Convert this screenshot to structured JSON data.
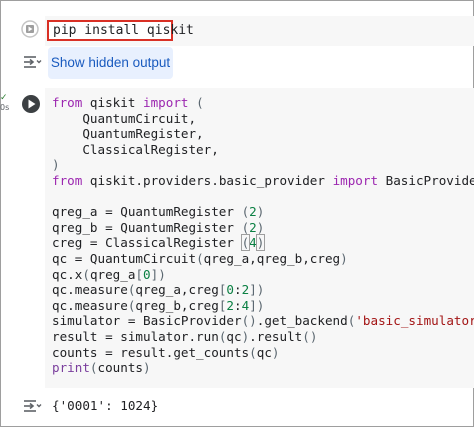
{
  "cell1": {
    "code": "pip install qiskit",
    "show_hidden_label": "Show hidden output"
  },
  "cell2": {
    "exec_status": "✓",
    "exec_time": "0s",
    "lines": [
      [
        [
          "kw",
          "from"
        ],
        [
          "t",
          " qiskit "
        ],
        [
          "kw",
          "import"
        ],
        [
          "t",
          " "
        ],
        [
          "p",
          "("
        ]
      ],
      [
        [
          "t",
          "    QuantumCircuit,"
        ]
      ],
      [
        [
          "t",
          "    QuantumRegister,"
        ]
      ],
      [
        [
          "t",
          "    ClassicalRegister,"
        ]
      ],
      [
        [
          "p",
          ")"
        ]
      ],
      [
        [
          "kw",
          "from"
        ],
        [
          "t",
          " qiskit.providers.basic_provider "
        ],
        [
          "kw",
          "import"
        ],
        [
          "t",
          " BasicProvider"
        ]
      ],
      [
        [
          "t",
          ""
        ]
      ],
      [
        [
          "t",
          "qreg_a = QuantumRegister "
        ],
        [
          "p",
          "("
        ],
        [
          "n",
          "2"
        ],
        [
          "p",
          ")"
        ]
      ],
      [
        [
          "t",
          "qreg_b = QuantumRegister "
        ],
        [
          "p",
          "("
        ],
        [
          "n",
          "2"
        ],
        [
          "p",
          ")"
        ]
      ],
      [
        [
          "t",
          "creg = ClassicalRegister "
        ],
        [
          "h",
          "("
        ],
        [
          "n",
          "4"
        ],
        [
          "h",
          ")"
        ],
        [
          "c",
          ""
        ]
      ],
      [
        [
          "t",
          "qc = QuantumCircuit"
        ],
        [
          "p",
          "("
        ],
        [
          "t",
          "qreg_a,qreg_b,creg"
        ],
        [
          "p",
          ")"
        ]
      ],
      [
        [
          "t",
          "qc.x"
        ],
        [
          "p",
          "("
        ],
        [
          "t",
          "qreg_a"
        ],
        [
          "p",
          "["
        ],
        [
          "n",
          "0"
        ],
        [
          "p",
          "])"
        ]
      ],
      [
        [
          "t",
          "qc.measure"
        ],
        [
          "p",
          "("
        ],
        [
          "t",
          "qreg_a,creg"
        ],
        [
          "p",
          "["
        ],
        [
          "n",
          "0"
        ],
        [
          "t",
          ":"
        ],
        [
          "n",
          "2"
        ],
        [
          "p",
          "])"
        ]
      ],
      [
        [
          "t",
          "qc.measure"
        ],
        [
          "p",
          "("
        ],
        [
          "t",
          "qreg_b,creg"
        ],
        [
          "p",
          "["
        ],
        [
          "n",
          "2"
        ],
        [
          "t",
          ":"
        ],
        [
          "n",
          "4"
        ],
        [
          "p",
          "])"
        ]
      ],
      [
        [
          "t",
          "simulator = BasicProvider"
        ],
        [
          "p",
          "()"
        ],
        [
          "t",
          ".get_backend"
        ],
        [
          "p",
          "("
        ],
        [
          "s",
          "'basic_simulator'"
        ],
        [
          "p",
          ")"
        ]
      ],
      [
        [
          "t",
          "result = simulator.run"
        ],
        [
          "p",
          "("
        ],
        [
          "t",
          "qc"
        ],
        [
          "p",
          ")"
        ],
        [
          "t",
          ".result"
        ],
        [
          "p",
          "()"
        ]
      ],
      [
        [
          "t",
          "counts = result.get_counts"
        ],
        [
          "p",
          "("
        ],
        [
          "t",
          "qc"
        ],
        [
          "p",
          ")"
        ]
      ],
      [
        [
          "f",
          "print"
        ],
        [
          "p",
          "("
        ],
        [
          "t",
          "counts"
        ],
        [
          "p",
          ")"
        ]
      ]
    ],
    "output": "{'0001': 1024}"
  },
  "colors": {
    "keyword": "#9c27b0",
    "number": "#0b8043",
    "string": "#a31515",
    "highlight_box": "#d93025",
    "button_bg": "#e8f0fe",
    "button_text": "#1a5bbf"
  },
  "icons": {
    "run_cell_1": "play-circle-icon",
    "run_cell_2": "play-circle-icon",
    "output_toggle": "output-collapse-icon"
  }
}
